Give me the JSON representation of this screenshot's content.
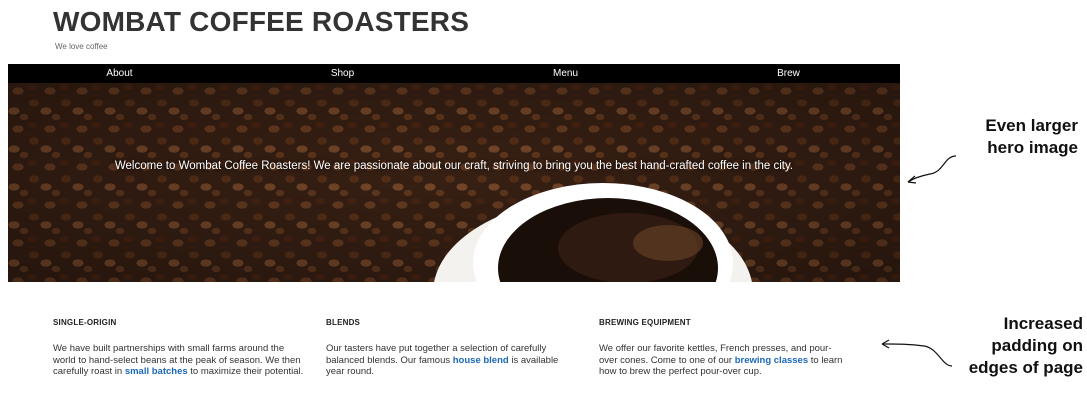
{
  "header": {
    "title": "WOMBAT COFFEE ROASTERS",
    "tagline": "We love coffee"
  },
  "nav": {
    "items": [
      "About",
      "Shop",
      "Menu",
      "Brew"
    ]
  },
  "hero": {
    "text": "Welcome to Wombat Coffee Roasters! We are passionate about our craft, striving to bring you the best hand-crafted coffee in the city."
  },
  "columns": [
    {
      "heading": "SINGLE-ORIGIN",
      "text_before": "We have built partnerships with small farms around the world to hand-select beans at the peak of season. We then carefully roast in ",
      "link": "small batches",
      "text_after": " to maximize their potential."
    },
    {
      "heading": "BLENDS",
      "text_before": "Our tasters have put together a selection of carefully balanced blends. Our famous ",
      "link": "house blend",
      "text_after": " is available year round."
    },
    {
      "heading": "BREWING EQUIPMENT",
      "text_before": "We offer our favorite kettles, French presses, and pour-over cones. Come to one of our ",
      "link": "brewing classes",
      "text_after": " to learn how to brew the perfect pour-over cup."
    }
  ],
  "annotations": {
    "hero_line1": "Even larger",
    "hero_line2": "hero image",
    "padding_line1": "Increased",
    "padding_line2": "padding on",
    "padding_line3": "edges of page"
  },
  "colors": {
    "nav_background": "#000000",
    "link": "#1c68b8"
  }
}
